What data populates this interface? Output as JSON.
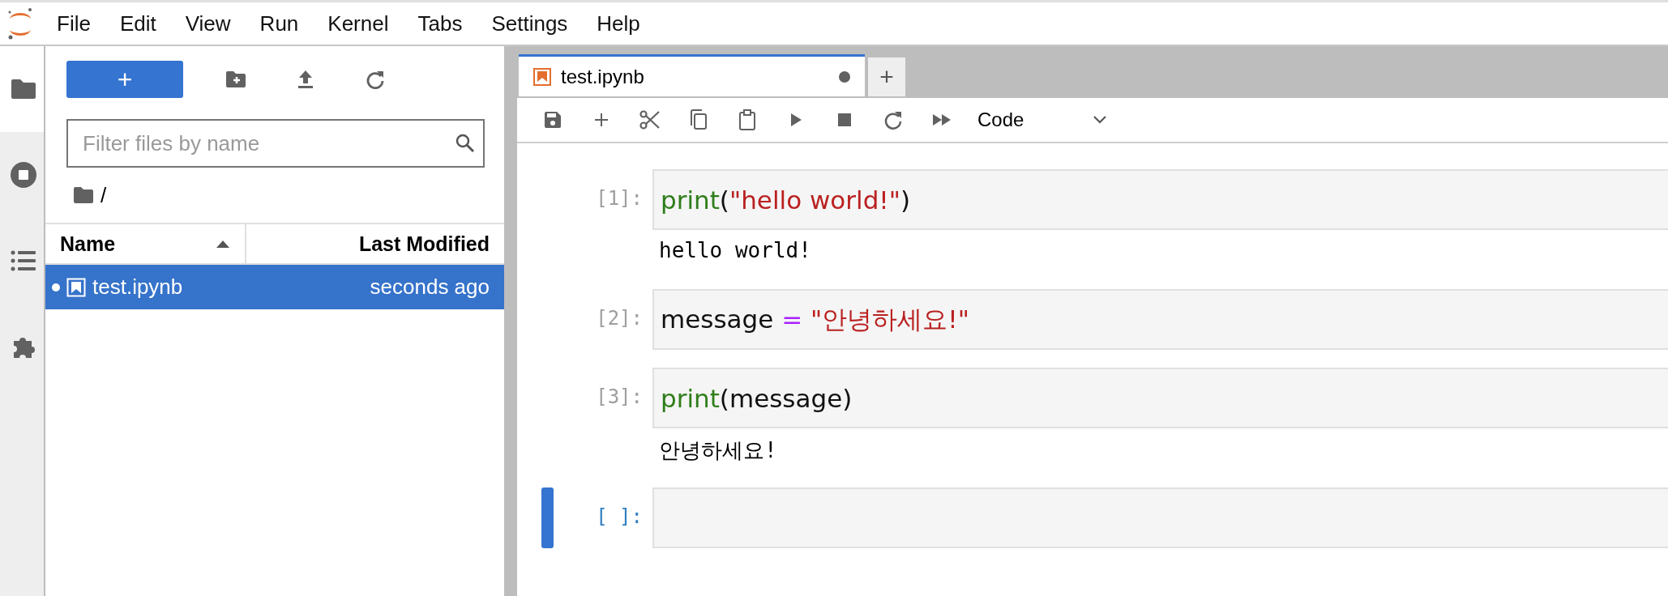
{
  "menu": [
    "File",
    "Edit",
    "View",
    "Run",
    "Kernel",
    "Tabs",
    "Settings",
    "Help"
  ],
  "activity_bar": [
    {
      "kind": "folder",
      "selected": true
    },
    {
      "kind": "stop",
      "selected": false
    },
    {
      "kind": "list",
      "selected": false
    },
    {
      "kind": "puzzle",
      "selected": false
    }
  ],
  "file_browser": {
    "new_button": "+",
    "filter": {
      "placeholder": "Filter files by name"
    },
    "breadcrumb": "/",
    "columns": [
      {
        "label": "Name",
        "sorted": true
      },
      {
        "label": "Last Modified"
      }
    ],
    "files": [
      {
        "name": "test.ipynb",
        "modified": "seconds ago",
        "running": true,
        "selected": true
      }
    ]
  },
  "notebook": {
    "tabs": [
      {
        "label": "test.ipynb",
        "dirty": true,
        "selected": true
      }
    ],
    "add_tab": "+",
    "cell_type": "Code",
    "cells": [
      {
        "prompt": "[1]:",
        "active": false,
        "source": [
          {
            "kind": "builtin",
            "text": "print"
          },
          {
            "kind": "plain",
            "text": "("
          },
          {
            "kind": "string",
            "text": "\"hello world!\""
          },
          {
            "kind": "plain",
            "text": ")"
          }
        ],
        "output": "hello world!"
      },
      {
        "prompt": "[2]:",
        "active": false,
        "source": [
          {
            "kind": "plain",
            "text": "message "
          },
          {
            "kind": "operator",
            "text": "="
          },
          {
            "kind": "string",
            "text": " \"안녕하세요!\""
          }
        ]
      },
      {
        "prompt": "[3]:",
        "active": false,
        "source": [
          {
            "kind": "builtin",
            "text": "print"
          },
          {
            "kind": "plain",
            "text": "(message)"
          }
        ],
        "output": "안녕하세요!"
      },
      {
        "prompt": "[ ]:",
        "active": true
      }
    ]
  }
}
